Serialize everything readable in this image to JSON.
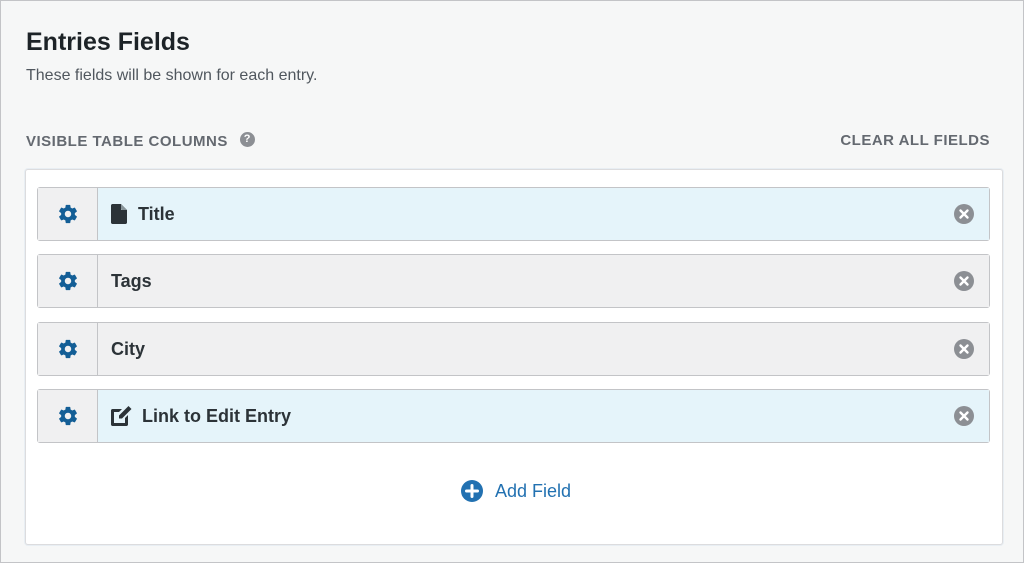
{
  "header": {
    "title": "Entries Fields",
    "description": "These fields will be shown for each entry."
  },
  "section": {
    "label": "VISIBLE TABLE COLUMNS",
    "help_glyph": "?",
    "clear_label": "CLEAR ALL FIELDS"
  },
  "fields": [
    {
      "label": "Title",
      "icon": "document-icon",
      "highlighted": true
    },
    {
      "label": "Tags",
      "icon": null,
      "highlighted": false
    },
    {
      "label": "City",
      "icon": null,
      "highlighted": false
    },
    {
      "label": "Link to Edit Entry",
      "icon": "edit-icon",
      "highlighted": true
    }
  ],
  "add_field": {
    "label": "Add Field",
    "icon": "plus-circle-icon"
  },
  "colors": {
    "accent": "#2271b1",
    "gear": "#135e96",
    "highlight_row": "#e5f4fa",
    "normal_row": "#f0f0f1",
    "remove_icon": "#8c8f94"
  }
}
